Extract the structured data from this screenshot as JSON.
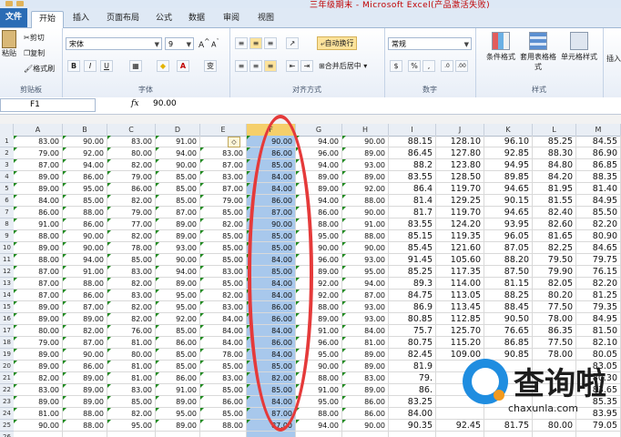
{
  "title": "三年级期末 - Microsoft Excel(产品激活失败)",
  "tabs": [
    {
      "label": "文件"
    },
    {
      "label": "开始"
    },
    {
      "label": "插入"
    },
    {
      "label": "页面布局"
    },
    {
      "label": "公式"
    },
    {
      "label": "数据"
    },
    {
      "label": "审阅"
    },
    {
      "label": "视图"
    }
  ],
  "ribbon": {
    "clipboard": {
      "paste": "粘贴",
      "cut": "剪切",
      "copy": "复制",
      "format_painter": "格式刷",
      "label": "剪贴板"
    },
    "font": {
      "name": "宋体",
      "size": "9",
      "bold": "B",
      "italic": "I",
      "underline": "U",
      "label": "字体",
      "wen": "变"
    },
    "alignment": {
      "wrap": "自动换行",
      "merge": "合并后居中",
      "label": "对齐方式"
    },
    "number": {
      "format": "常规",
      "percent": "%",
      "comma": ",",
      "label": "数字"
    },
    "styles": {
      "conditional": "条件格式",
      "table": "套用表格格式",
      "cell": "单元格样式",
      "label": "样式",
      "insert": "插入"
    }
  },
  "formula_bar": {
    "name_box": "F1",
    "fx": "fx",
    "value": "90.00"
  },
  "columns": [
    "A",
    "B",
    "C",
    "D",
    "E",
    "F",
    "G",
    "H",
    "I",
    "J",
    "K",
    "L",
    "M"
  ],
  "rows": [
    {
      "n": "1",
      "c": [
        "83.00",
        "90.00",
        "83.00",
        "91.00",
        "",
        "90.00",
        "94.00",
        "90.00",
        "88.15",
        "128.10",
        "96.10",
        "85.25",
        "84.55"
      ]
    },
    {
      "n": "2",
      "c": [
        "79.00",
        "92.00",
        "80.00",
        "94.00",
        "83.00",
        "86.00",
        "96.00",
        "89.00",
        "86.45",
        "127.80",
        "92.85",
        "88.30",
        "86.90"
      ]
    },
    {
      "n": "3",
      "c": [
        "87.00",
        "94.00",
        "82.00",
        "90.00",
        "87.00",
        "85.00",
        "94.00",
        "93.00",
        "88.2",
        "123.80",
        "94.95",
        "84.80",
        "86.85"
      ]
    },
    {
      "n": "4",
      "c": [
        "89.00",
        "86.00",
        "79.00",
        "85.00",
        "83.00",
        "84.00",
        "89.00",
        "89.00",
        "83.55",
        "128.50",
        "89.85",
        "84.20",
        "88.35"
      ]
    },
    {
      "n": "5",
      "c": [
        "89.00",
        "95.00",
        "86.00",
        "85.00",
        "87.00",
        "84.00",
        "89.00",
        "92.00",
        "86.4",
        "119.70",
        "94.65",
        "81.95",
        "81.40"
      ]
    },
    {
      "n": "6",
      "c": [
        "84.00",
        "85.00",
        "82.00",
        "85.00",
        "79.00",
        "86.00",
        "94.00",
        "88.00",
        "81.4",
        "129.25",
        "90.15",
        "81.55",
        "84.95"
      ]
    },
    {
      "n": "7",
      "c": [
        "86.00",
        "88.00",
        "79.00",
        "87.00",
        "85.00",
        "87.00",
        "86.00",
        "90.00",
        "81.7",
        "119.70",
        "94.65",
        "82.40",
        "85.50"
      ]
    },
    {
      "n": "8",
      "c": [
        "91.00",
        "86.00",
        "77.00",
        "89.00",
        "82.00",
        "90.00",
        "88.00",
        "91.00",
        "83.55",
        "124.20",
        "93.95",
        "82.60",
        "82.20"
      ]
    },
    {
      "n": "9",
      "c": [
        "88.00",
        "90.00",
        "82.00",
        "89.00",
        "85.00",
        "85.00",
        "95.00",
        "88.00",
        "85.15",
        "119.35",
        "96.05",
        "81.65",
        "80.90"
      ]
    },
    {
      "n": "10",
      "c": [
        "89.00",
        "90.00",
        "78.00",
        "93.00",
        "85.00",
        "85.00",
        "90.00",
        "90.00",
        "85.45",
        "121.60",
        "87.05",
        "82.25",
        "84.65"
      ]
    },
    {
      "n": "11",
      "c": [
        "88.00",
        "94.00",
        "85.00",
        "90.00",
        "85.00",
        "84.00",
        "96.00",
        "93.00",
        "91.45",
        "105.60",
        "88.20",
        "79.50",
        "79.75"
      ]
    },
    {
      "n": "12",
      "c": [
        "87.00",
        "91.00",
        "83.00",
        "94.00",
        "83.00",
        "85.00",
        "89.00",
        "95.00",
        "85.25",
        "117.35",
        "87.50",
        "79.90",
        "76.15"
      ]
    },
    {
      "n": "13",
      "c": [
        "87.00",
        "88.00",
        "82.00",
        "89.00",
        "85.00",
        "84.00",
        "92.00",
        "94.00",
        "89.3",
        "114.00",
        "81.15",
        "82.05",
        "82.20"
      ]
    },
    {
      "n": "14",
      "c": [
        "87.00",
        "86.00",
        "83.00",
        "95.00",
        "82.00",
        "84.00",
        "92.00",
        "87.00",
        "84.75",
        "113.05",
        "88.25",
        "80.20",
        "81.25"
      ]
    },
    {
      "n": "15",
      "c": [
        "89.00",
        "87.00",
        "82.00",
        "95.00",
        "83.00",
        "86.00",
        "88.00",
        "93.00",
        "86.9",
        "113.45",
        "88.45",
        "77.50",
        "79.35"
      ]
    },
    {
      "n": "16",
      "c": [
        "89.00",
        "89.00",
        "82.00",
        "92.00",
        "84.00",
        "86.00",
        "89.00",
        "93.00",
        "80.85",
        "112.85",
        "90.50",
        "78.00",
        "84.95"
      ]
    },
    {
      "n": "17",
      "c": [
        "80.00",
        "82.00",
        "76.00",
        "85.00",
        "84.00",
        "84.00",
        "91.00",
        "84.00",
        "75.7",
        "125.70",
        "76.65",
        "86.35",
        "81.50"
      ]
    },
    {
      "n": "18",
      "c": [
        "79.00",
        "87.00",
        "81.00",
        "86.00",
        "84.00",
        "86.00",
        "96.00",
        "81.00",
        "80.75",
        "115.20",
        "86.85",
        "77.50",
        "82.10"
      ]
    },
    {
      "n": "19",
      "c": [
        "89.00",
        "90.00",
        "80.00",
        "85.00",
        "78.00",
        "84.00",
        "95.00",
        "89.00",
        "82.45",
        "109.00",
        "90.85",
        "78.00",
        "80.05"
      ]
    },
    {
      "n": "20",
      "c": [
        "89.00",
        "86.00",
        "81.00",
        "85.00",
        "85.00",
        "85.00",
        "90.00",
        "89.00",
        "81.9",
        "",
        "",
        "",
        "83.05"
      ]
    },
    {
      "n": "21",
      "c": [
        "82.00",
        "89.00",
        "81.00",
        "86.00",
        "83.00",
        "82.00",
        "88.00",
        "83.00",
        "79.",
        "",
        "",
        "",
        "80.30"
      ]
    },
    {
      "n": "22",
      "c": [
        "83.00",
        "89.00",
        "83.00",
        "91.00",
        "85.00",
        "85.00",
        "91.00",
        "89.00",
        "86.",
        "",
        "",
        "",
        "83.65"
      ]
    },
    {
      "n": "23",
      "c": [
        "89.00",
        "89.00",
        "85.00",
        "89.00",
        "86.00",
        "84.00",
        "95.00",
        "86.00",
        "83.25",
        "",
        "",
        "",
        "85.35"
      ]
    },
    {
      "n": "24",
      "c": [
        "81.00",
        "88.00",
        "82.00",
        "95.00",
        "85.00",
        "87.00",
        "88.00",
        "86.00",
        "84.00",
        "",
        "",
        "",
        "83.95"
      ]
    },
    {
      "n": "25",
      "c": [
        "90.00",
        "88.00",
        "95.00",
        "89.00",
        "88.00",
        "87.00",
        "94.00",
        "90.00",
        "90.35",
        "92.45",
        "81.75",
        "80.00",
        "79.05"
      ]
    },
    {
      "n": "26",
      "c": [
        "",
        "",
        "",
        "",
        "",
        "",
        "",
        "",
        "",
        "",
        "",
        "",
        ""
      ]
    }
  ],
  "watermark": {
    "text": "查询啦",
    "url": "chaxunla.com"
  }
}
